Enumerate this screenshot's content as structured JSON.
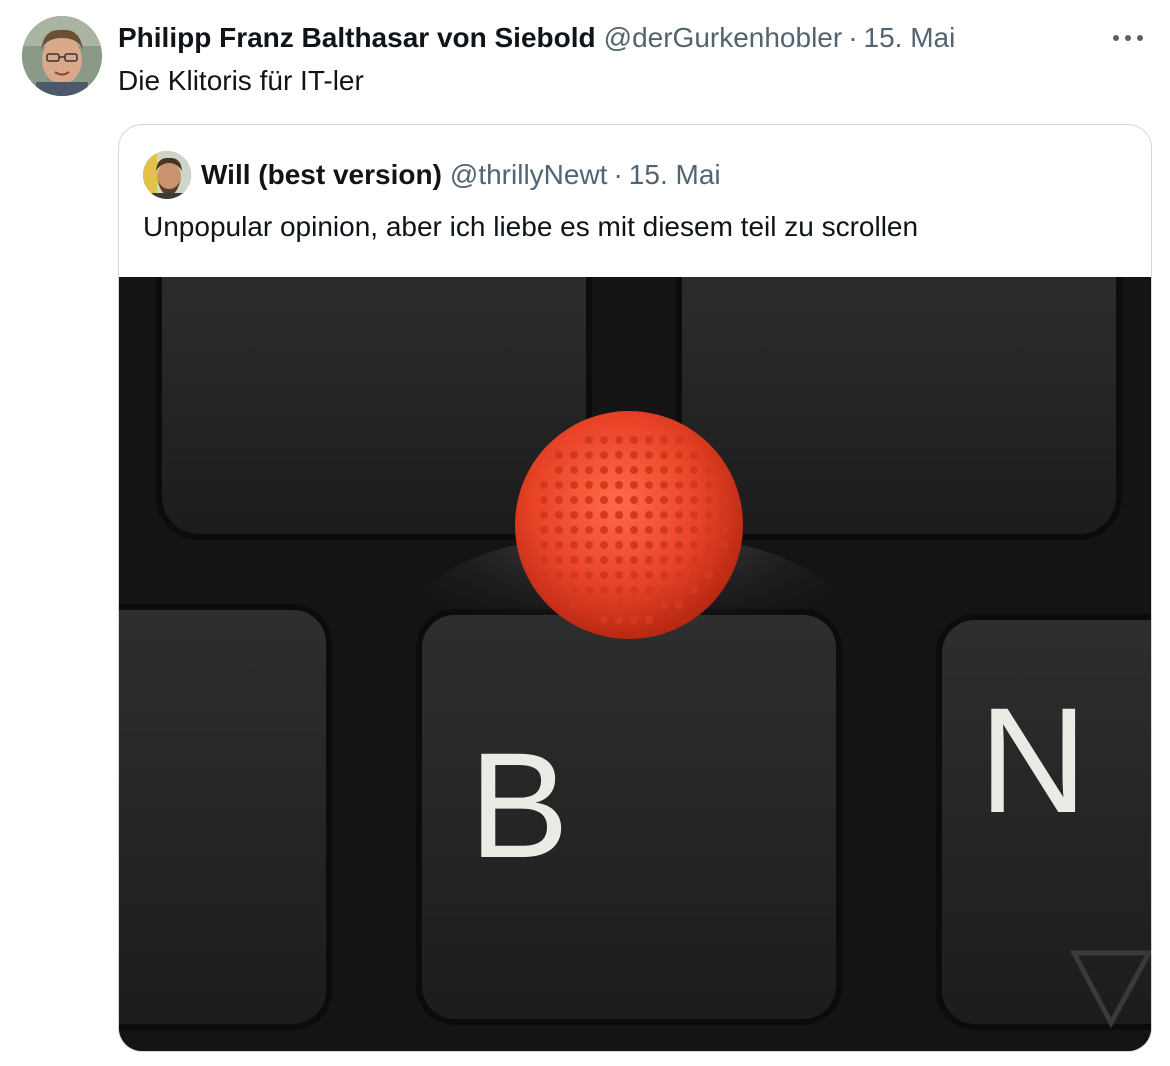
{
  "tweet": {
    "author_name": "Philipp Franz Balthasar von Siebold",
    "author_handle": "@derGurkenhobler",
    "separator": "·",
    "date": "15. Mai",
    "text": "Die Klitoris für IT-ler",
    "more_icon": "ellipsis-icon"
  },
  "quoted": {
    "author_name": "Will (best version)",
    "author_handle": "@thrillyNewt",
    "separator": "·",
    "date": "15. Mai",
    "text": "Unpopular opinion, aber ich liebe es mit diesem teil zu scrollen",
    "media": {
      "key_b_label": "B",
      "key_n_label": "N",
      "trackpoint_color": "#e8402a"
    }
  },
  "colors": {
    "text_primary": "#0f1419",
    "text_secondary": "#536471",
    "border": "#cfd9de"
  }
}
